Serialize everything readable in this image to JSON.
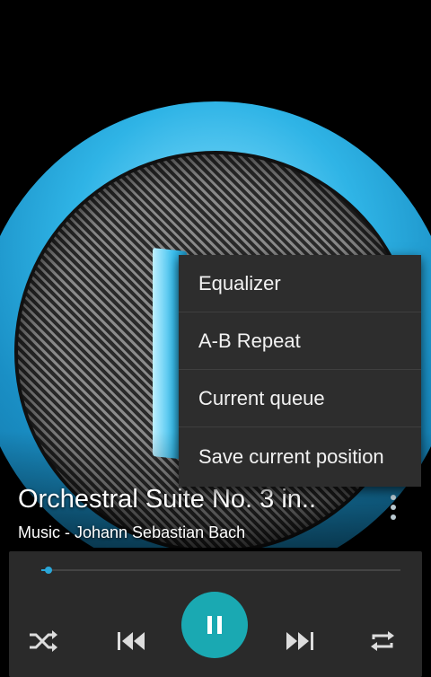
{
  "track": {
    "title": "Orchestral Suite No. 3 in..",
    "subtitle": "Music - Johann Sebastian Bach"
  },
  "menu": {
    "items": [
      {
        "label": "Equalizer"
      },
      {
        "label": "A-B Repeat"
      },
      {
        "label": "Current queue"
      },
      {
        "label": "Save current position"
      }
    ]
  },
  "player": {
    "progress": 0.02,
    "state": "playing",
    "icons": [
      "shuffle-icon",
      "previous-icon",
      "pause-icon",
      "next-icon",
      "repeat-icon"
    ]
  },
  "colors": {
    "accent": "#1aa9b2",
    "seek": "#2aa7d9",
    "ring": "#2fb4e6"
  }
}
